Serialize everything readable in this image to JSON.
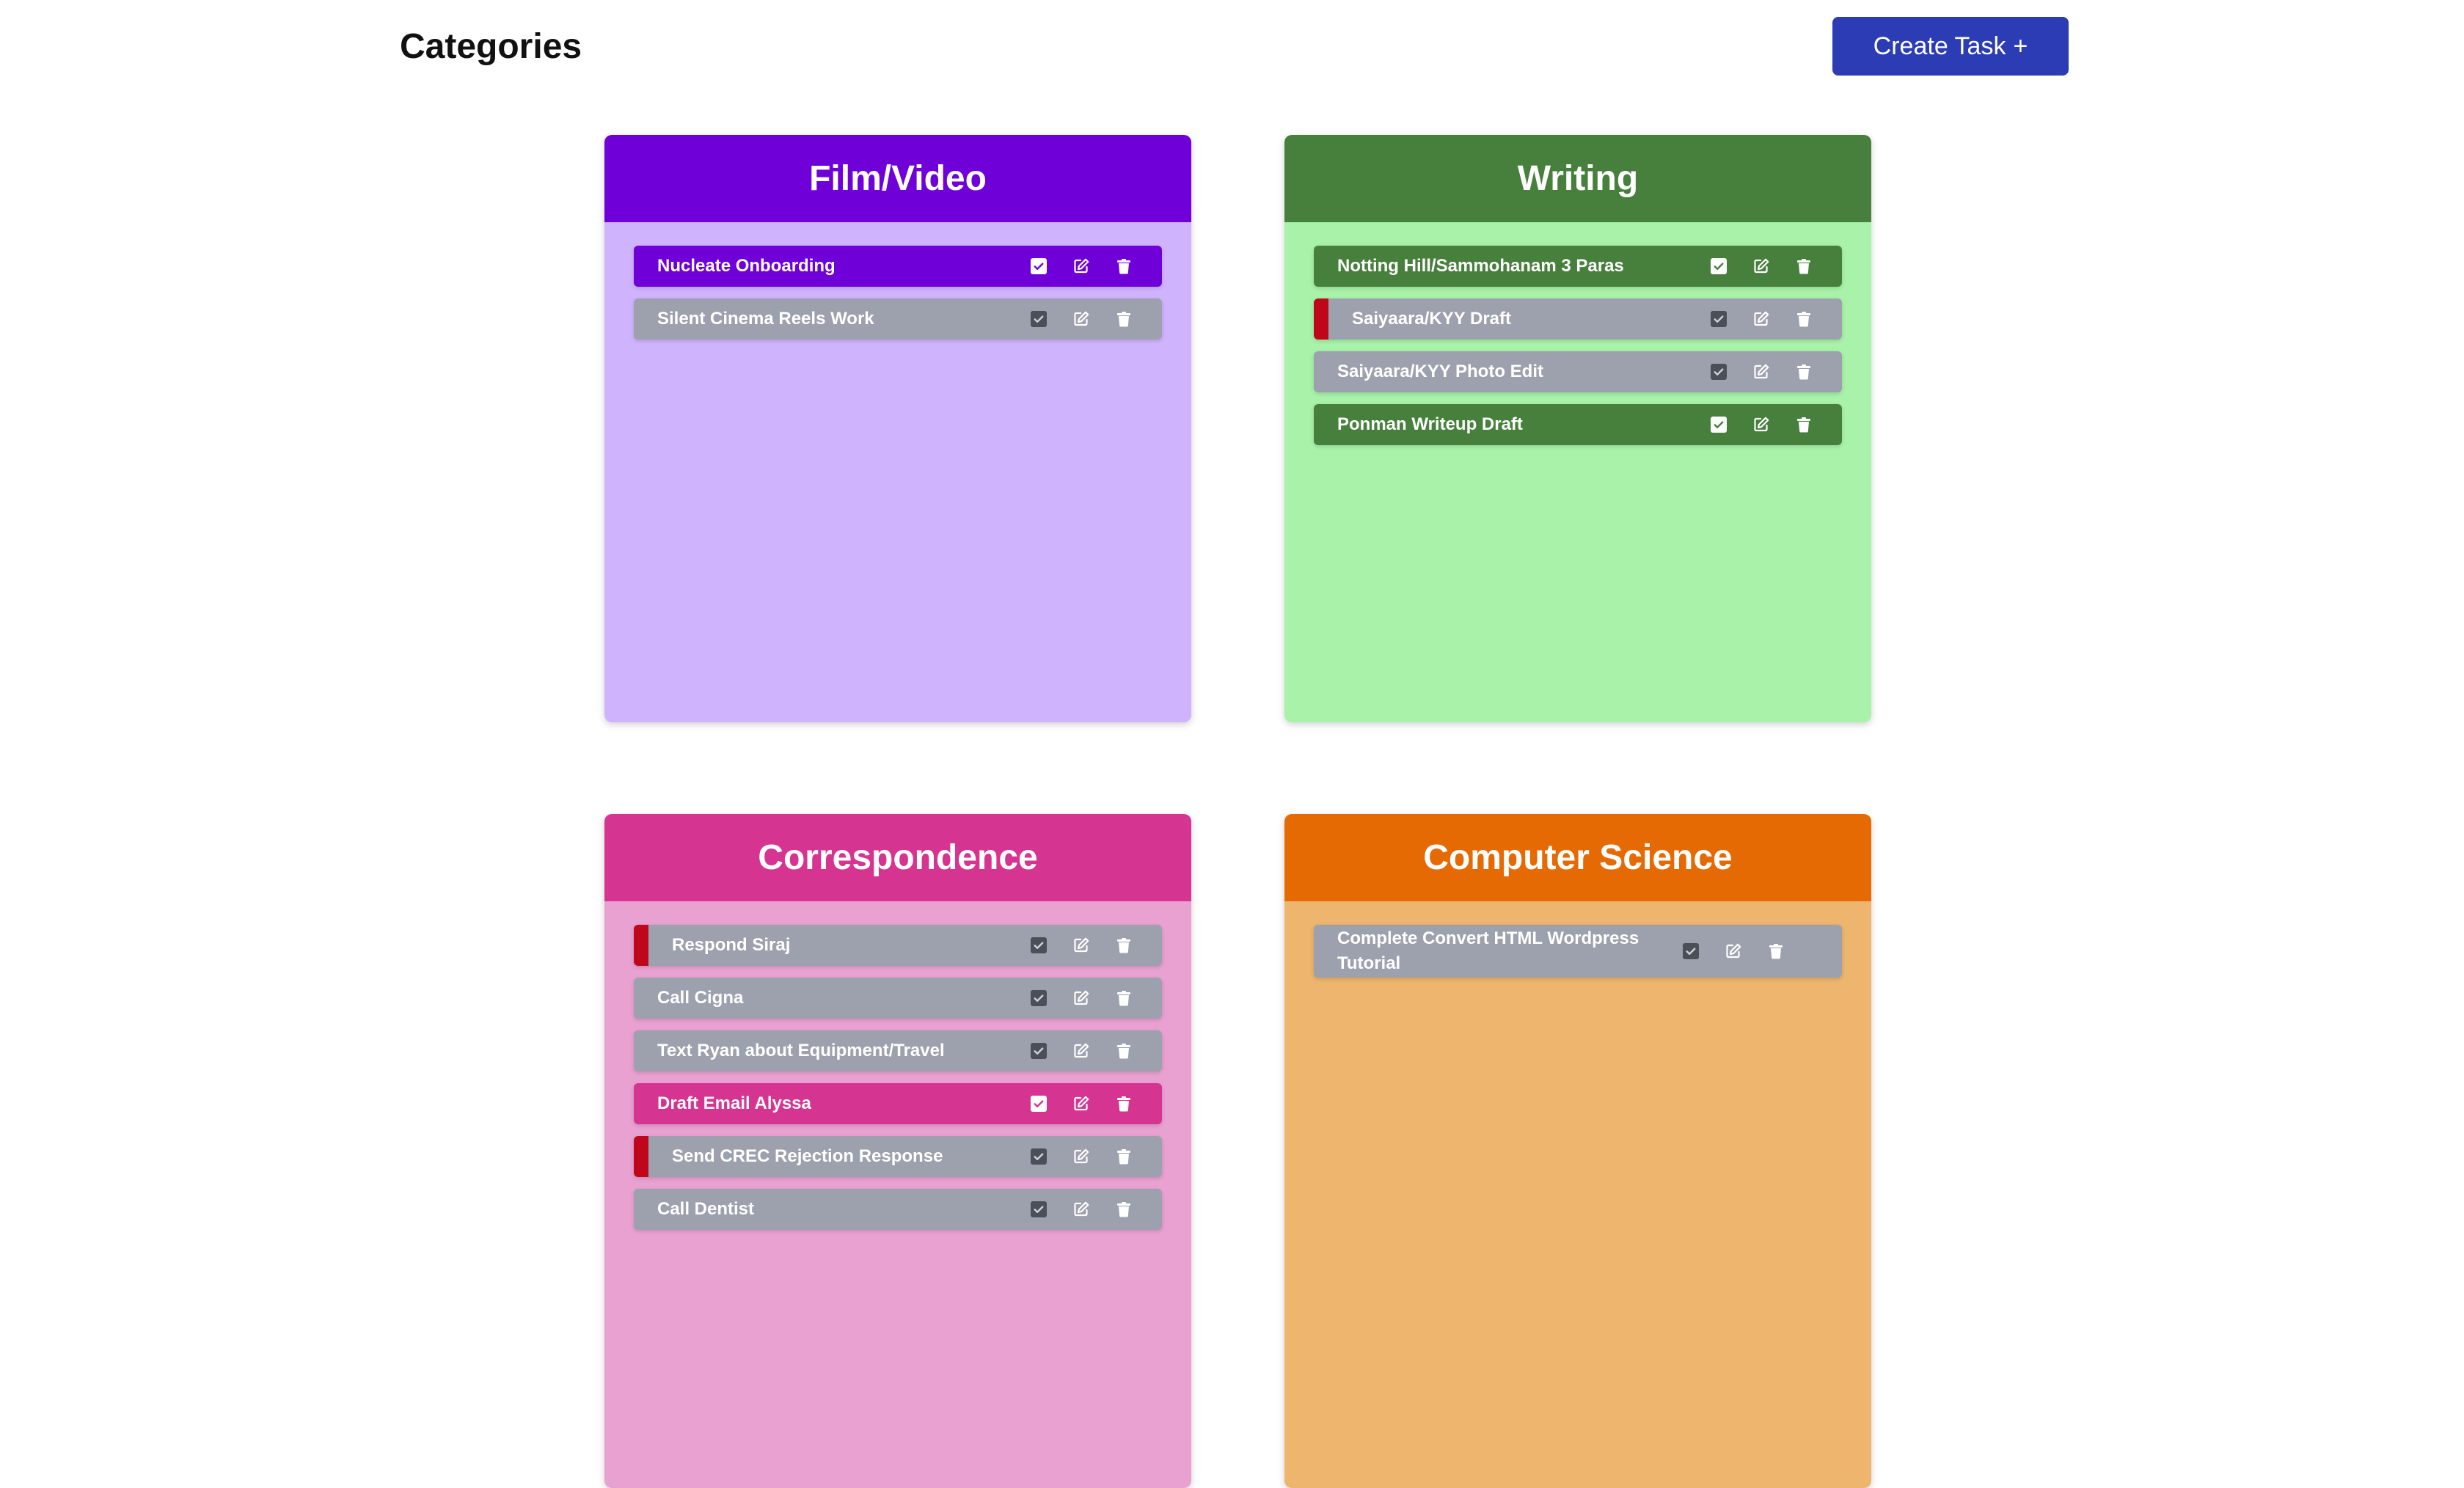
{
  "header": {
    "title": "Categories",
    "create_button": {
      "label": "Create Task",
      "symbol": "+",
      "color": "#2b3cb5"
    }
  },
  "categories": [
    {
      "name": "Film/Video",
      "header_color": "#6f00d8",
      "body_color": "#cfb3fd",
      "tasks": [
        {
          "label": "Nucleate Onboarding",
          "style": "highlight",
          "flagged": false
        },
        {
          "label": "Silent Cinema Reels Work",
          "style": "normal",
          "flagged": false
        }
      ]
    },
    {
      "name": "Writing",
      "header_color": "#47803c",
      "body_color": "#a8f2a9",
      "tasks": [
        {
          "label": "Notting Hill/Sammohanam 3 Paras",
          "style": "highlight",
          "flagged": false
        },
        {
          "label": "Saiyaara/KYY Draft",
          "style": "normal",
          "flagged": true
        },
        {
          "label": "Saiyaara/KYY Photo Edit",
          "style": "normal",
          "flagged": false
        },
        {
          "label": "Ponman Writeup Draft",
          "style": "highlight",
          "flagged": false
        }
      ]
    },
    {
      "name": "Correspondence",
      "header_color": "#d63491",
      "body_color": "#e9a1d1",
      "tasks": [
        {
          "label": "Respond Siraj",
          "style": "normal",
          "flagged": true
        },
        {
          "label": "Call Cigna",
          "style": "normal",
          "flagged": false
        },
        {
          "label": "Text Ryan about Equipment/Travel",
          "style": "normal",
          "flagged": false
        },
        {
          "label": "Draft Email Alyssa",
          "style": "highlight",
          "flagged": false
        },
        {
          "label": "Send CREC Rejection Response",
          "style": "normal",
          "flagged": true
        },
        {
          "label": "Call Dentist",
          "style": "normal",
          "flagged": false
        }
      ]
    },
    {
      "name": "Computer Science",
      "header_color": "#e66a04",
      "body_color": "#edb56d",
      "tasks": [
        {
          "label": "Complete Convert HTML Wordpress Tutorial",
          "style": "normal",
          "flagged": false
        }
      ]
    }
  ],
  "task_colors": {
    "normal": "#9ca1ad",
    "flag": "#c0061a"
  },
  "icons": {
    "complete": "checkbox-icon",
    "edit": "edit-icon",
    "delete": "trash-icon"
  }
}
